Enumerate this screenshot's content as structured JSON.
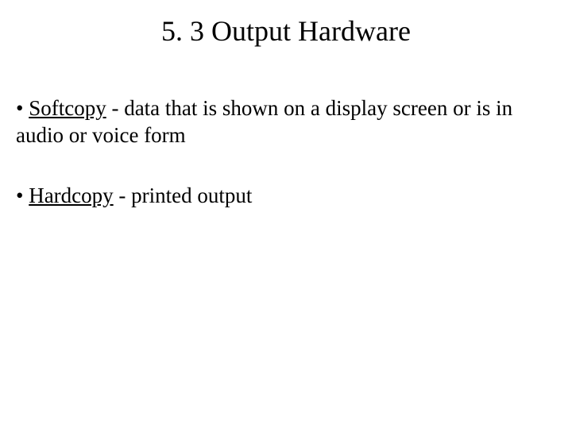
{
  "title": "5. 3 Output Hardware",
  "bullets": [
    {
      "prefix": "• ",
      "term": "Softcopy",
      "definition": " - data that is shown on a display screen or is in audio or voice form"
    },
    {
      "prefix": "• ",
      "term": "Hardcopy",
      "definition": " - printed output"
    }
  ]
}
